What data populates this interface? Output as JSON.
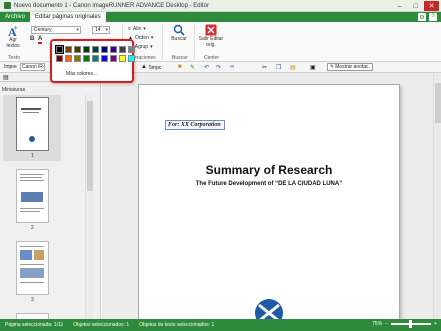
{
  "window": {
    "title": "Nuevo documento 1 - Canon imageRUNNER ADVANCE Desktop - Editor",
    "min_label": "–",
    "max_label": "□",
    "close_label": "✕"
  },
  "tabs": [
    {
      "label": "Archivo"
    },
    {
      "label": "Editar páginas originales"
    }
  ],
  "ribbon": {
    "add_text_label": "Agr textos",
    "font_name": "Century",
    "font_size": "14",
    "alignment_label": "Alin",
    "order_label": "Orden",
    "group_label": "Agrup",
    "search_label": "Buscar",
    "exit_label": "Salir Editar orig.",
    "group_text": "Texto",
    "group_operations": "eraciones",
    "group_search": "Buscar",
    "group_center": "Center"
  },
  "toolbar": {
    "printer_label": "Impre",
    "printer_value": "Canon iR-A",
    "steps_label": "5mpc",
    "show_notes_label": "Mostrar anotac."
  },
  "left_panel": {
    "tab_label": "Miniaturas",
    "thumbs": [
      {
        "page": "1"
      },
      {
        "page": "2"
      },
      {
        "page": "3"
      }
    ]
  },
  "document": {
    "annotation_text": "For: XX Corporation",
    "title": "Summary of Research",
    "subtitle": "The Future Development of “DE LA CIUDAD LUNA”"
  },
  "color_popup": {
    "more_colors_label": "Más colores...",
    "swatches": [
      "#000000",
      "#7f3f00",
      "#3f3f00",
      "#004000",
      "#003f3f",
      "#00007f",
      "#3f007f",
      "#3f3f3f",
      "#808080",
      "#800000",
      "#ff6600",
      "#808000",
      "#008000",
      "#008080",
      "#0000ff",
      "#800080",
      "#ffff00",
      "#00ffff"
    ]
  },
  "statusbar": {
    "page_selected": "Página seleccionada: 1/11",
    "objects_selected": "Objetos seleccionados: 1",
    "text_objects_selected": "Objetos de texto seleccionados: 1",
    "zoom": "75%"
  },
  "colors": {
    "accent": "#2e8b3e",
    "popup_border": "#d81b1b"
  }
}
